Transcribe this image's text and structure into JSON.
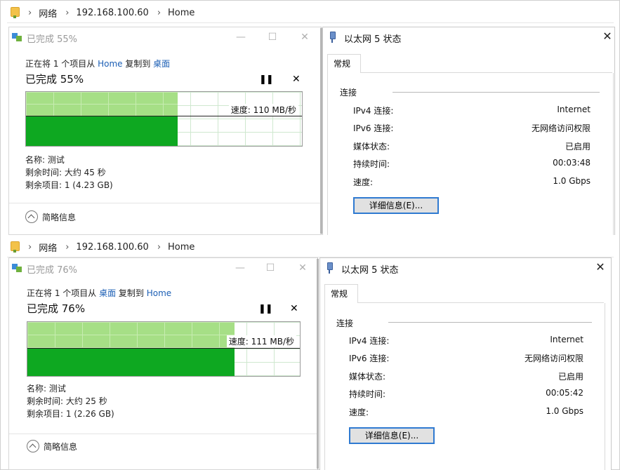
{
  "sections": [
    {
      "address": {
        "items": [
          "网络",
          "192.168.100.60",
          "Home"
        ]
      },
      "copy": {
        "title": "已完成 55%",
        "desc_prefix": "正在将 1 个项目从 ",
        "from": "Home",
        "desc_mid": " 复制到 ",
        "to": "桌面",
        "percent": "已完成 55%",
        "progress": 0.55,
        "speed": "速度: 110 MB/秒",
        "name_line": "名称: 测试",
        "time_line": "剩余时间: 大约 45 秒",
        "items_line": "剩余项目: 1 (4.23 GB)",
        "less_info": "简略信息"
      },
      "eth": {
        "title": "以太网 5 状态",
        "tab": "常规",
        "group": "连接",
        "rows": [
          {
            "k": "IPv4 连接:",
            "v": "Internet"
          },
          {
            "k": "IPv6 连接:",
            "v": "无网络访问权限"
          },
          {
            "k": "媒体状态:",
            "v": "已启用"
          },
          {
            "k": "持续时间:",
            "v": "00:03:48"
          },
          {
            "k": "速度:",
            "v": "1.0 Gbps"
          }
        ],
        "detail_button": "详细信息(E)..."
      }
    },
    {
      "address": {
        "items": [
          "网络",
          "192.168.100.60",
          "Home"
        ]
      },
      "copy": {
        "title": "已完成 76%",
        "desc_prefix": "正在将 1 个项目从 ",
        "from": "桌面",
        "desc_mid": " 复制到 ",
        "to": "Home",
        "percent": "已完成 76%",
        "progress": 0.76,
        "speed": "速度: 111 MB/秒",
        "name_line": "名称: 测试",
        "time_line": "剩余时间: 大约 25 秒",
        "items_line": "剩余项目: 1 (2.26 GB)",
        "less_info": "简略信息"
      },
      "eth": {
        "title": "以太网 5 状态",
        "tab": "常规",
        "group": "连接",
        "rows": [
          {
            "k": "IPv4 连接:",
            "v": "Internet"
          },
          {
            "k": "IPv6 连接:",
            "v": "无网络访问权限"
          },
          {
            "k": "媒体状态:",
            "v": "已启用"
          },
          {
            "k": "持续时间:",
            "v": "00:05:42"
          },
          {
            "k": "速度:",
            "v": "1.0 Gbps"
          }
        ],
        "detail_button": "详细信息(E)..."
      }
    }
  ],
  "window_buttons": {
    "minimize": "—",
    "maximize": "☐",
    "close": "✕",
    "pause": "❚❚",
    "cancel": "✕"
  },
  "colors": {
    "graph_done_top": "#a6df86",
    "graph_done_bottom": "#0ea821",
    "link": "#1c5fb5",
    "focus_border": "#2f7ad1"
  }
}
